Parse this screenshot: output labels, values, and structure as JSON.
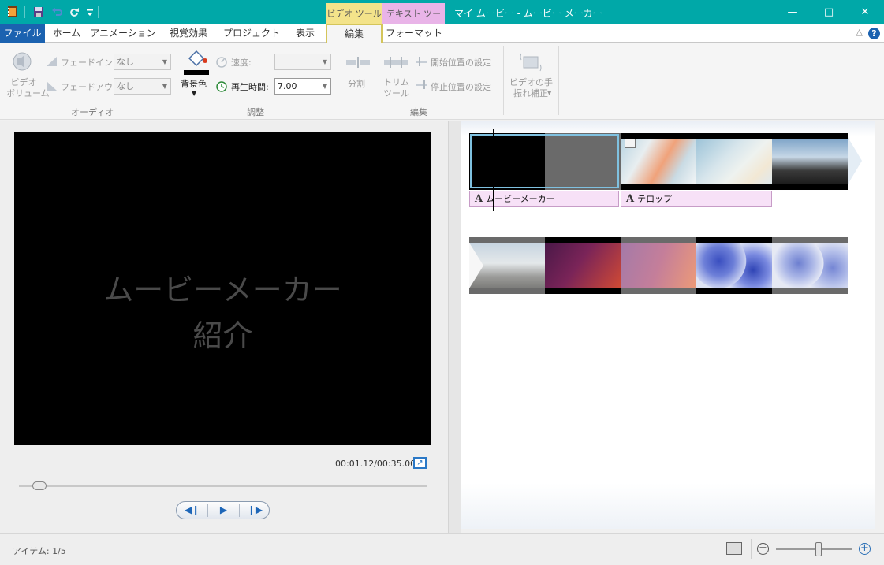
{
  "window": {
    "title": "マイ ムービー - ムービー メーカー",
    "context_tabs": {
      "video_tools": "ビデオ ツール",
      "text_tools": "テキスト ツール"
    },
    "controls": [
      "minimize-icon",
      "maximize-icon",
      "close-icon"
    ]
  },
  "quick_access": [
    "moviemaker-app-icon",
    "save-icon",
    "undo-icon",
    "redo-icon",
    "customize-icon"
  ],
  "tabs": [
    {
      "label": "ファイル"
    },
    {
      "label": "ホーム"
    },
    {
      "label": "アニメーション"
    },
    {
      "label": "視覚効果"
    },
    {
      "label": "プロジェクト"
    },
    {
      "label": "表示"
    },
    {
      "label": "編集",
      "selected": true
    },
    {
      "label": "フォーマット"
    }
  ],
  "ribbon": {
    "audio": {
      "group_label": "オーディオ",
      "video_volume": "ビデオ\nボリューム",
      "fade_in_label": "フェードイン:",
      "fade_in_value": "なし",
      "fade_out_label": "フェードアウト:",
      "fade_out_value": "なし"
    },
    "adjust": {
      "group_label": "調整",
      "background_color": "背景色",
      "background_color_value": "#000000",
      "speed_label": "速度:",
      "speed_value": "",
      "duration_label": "再生時間:",
      "duration_value": "7.00"
    },
    "edit": {
      "group_label": "編集",
      "split": "分割",
      "trim_tool": "トリム\nツール",
      "set_start": "開始位置の設定",
      "set_end": "停止位置の設定"
    },
    "stabilization": {
      "label": "ビデオの手\n振れ補正"
    }
  },
  "preview": {
    "text_line1": "ムービーメーカー",
    "text_line2": "紹介",
    "timecode": "00:01.12/00:35.00",
    "seek_position": 0.032
  },
  "storyboard": {
    "captions": [
      {
        "text": "ムービーメーカー"
      },
      {
        "text": "テロップ"
      }
    ]
  },
  "status": {
    "items_label": "アイテム: 1/5",
    "zoom_level": 0.6
  }
}
